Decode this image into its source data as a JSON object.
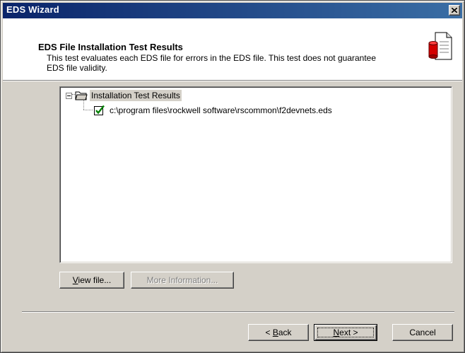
{
  "window": {
    "title": "EDS Wizard"
  },
  "header": {
    "title": "EDS File Installation Test Results",
    "description": "This test evaluates each EDS file for errors in the EDS file. This test does not guarantee EDS file validity."
  },
  "tree": {
    "root": {
      "label": "Installation Test Results",
      "icon": "folder-icon",
      "expanded": true
    },
    "children": [
      {
        "label": "c:\\program files\\rockwell software\\rscommon\\f2devnets.eds",
        "icon": "checkmark-icon",
        "status": "passed"
      }
    ]
  },
  "buttons": {
    "view_file": {
      "underline_char": "V",
      "rest": "iew file..."
    },
    "more_info": {
      "label": "More Information..."
    },
    "back": {
      "prefix": "< ",
      "underline_char": "B",
      "rest": "ack"
    },
    "next": {
      "underline_char": "N",
      "rest": "ext >"
    },
    "cancel": {
      "label": "Cancel"
    }
  },
  "colors": {
    "titlebar_start": "#0a246a",
    "titlebar_end": "#3a6ea5",
    "face": "#d4d0c8",
    "check": "#008000"
  }
}
